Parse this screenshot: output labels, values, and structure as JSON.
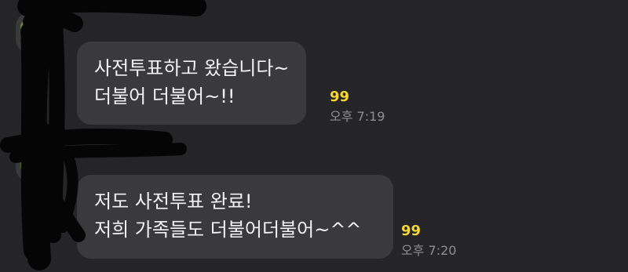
{
  "messages": [
    {
      "lines": [
        "사전투표하고 왔습니다~",
        "더불어 더불어~!!"
      ],
      "unread_count": "99",
      "time": "오후 7:19"
    },
    {
      "lines": [
        "저도 사전투표 완료!",
        "저희 가족들도 더불어더불어~^^"
      ],
      "unread_count": "99",
      "time": "오후 7:20"
    }
  ],
  "colors": {
    "background": "#252527",
    "bubble": "#3a3a3c",
    "bubble_text": "#f2f2f2",
    "unread_count": "#f7d633",
    "timestamp": "#8e8e93",
    "redaction": "#050505"
  },
  "icons": {
    "avatar": "profile-avatar-icon"
  }
}
